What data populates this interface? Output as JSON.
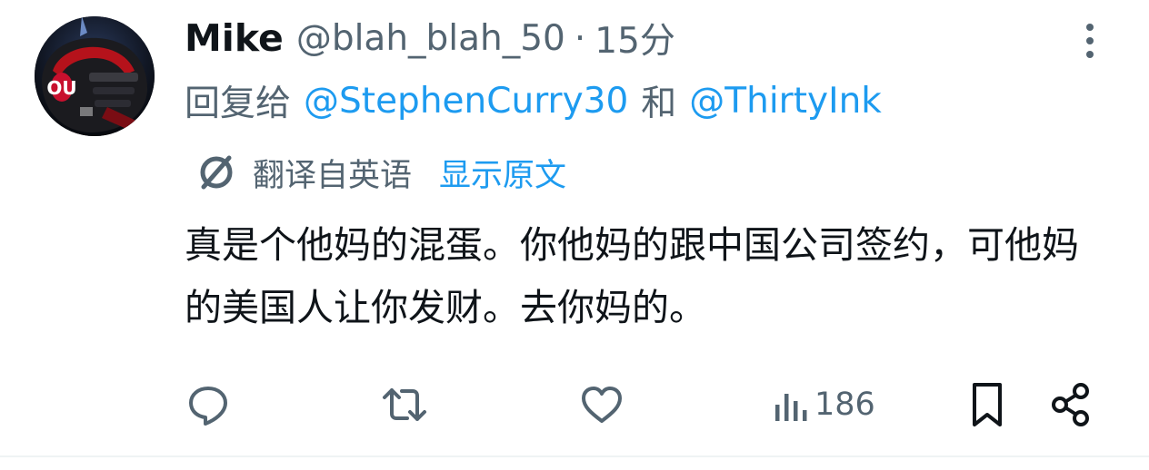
{
  "tweet": {
    "author_name": "Mike",
    "author_handle": "@blah_blah_50",
    "separator": "·",
    "time": "15分",
    "reply_label": "回复给",
    "reply_mention_1": "@StephenCurry30",
    "reply_and": "和",
    "reply_mention_2": "@ThirtyInk",
    "translated_label": "翻译自英语",
    "show_original": "显示原文",
    "text": "真是个他妈的混蛋。你他妈的跟中国公司签约，可他妈的美国人让你发财。去你妈的。"
  },
  "actions": {
    "views_count": "186"
  },
  "colors": {
    "accent": "#1d9bf0",
    "secondary_text": "#536471",
    "primary_text": "#0f1419"
  },
  "icons": {
    "more": "more-vertical-icon",
    "translate": "translate-icon",
    "reply": "reply-icon",
    "retweet": "retweet-icon",
    "like": "like-icon",
    "views": "views-icon",
    "bookmark": "bookmark-icon",
    "share": "share-icon"
  }
}
